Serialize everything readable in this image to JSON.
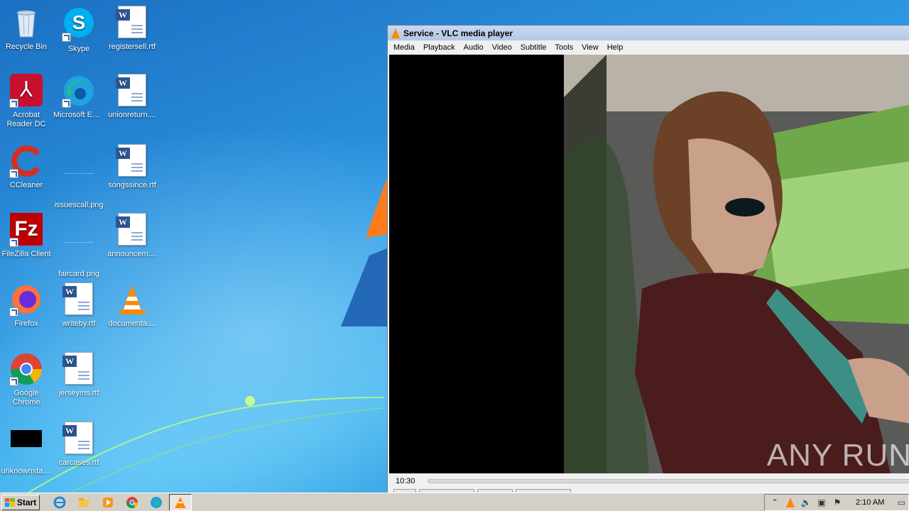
{
  "desktop": {
    "icons": [
      {
        "label": "Recycle Bin",
        "icon": "recycle-bin-icon"
      },
      {
        "label": "Skype",
        "icon": "skype-icon"
      },
      {
        "label": "registersell.rtf",
        "icon": "word-document-icon"
      },
      {
        "label": "Acrobat Reader DC",
        "icon": "acrobat-icon"
      },
      {
        "label": "Microsoft Edge",
        "icon": "edge-icon"
      },
      {
        "label": "unionreturn....",
        "icon": "word-document-icon"
      },
      {
        "label": "CCleaner",
        "icon": "ccleaner-icon"
      },
      {
        "label": "issuescall.png",
        "icon": "png-file-icon"
      },
      {
        "label": "songssince.rtf",
        "icon": "word-document-icon"
      },
      {
        "label": "FileZilla Client",
        "icon": "filezilla-icon"
      },
      {
        "label": "faircard.png",
        "icon": "png-file-icon"
      },
      {
        "label": "announcem....",
        "icon": "word-document-icon"
      },
      {
        "label": "Firefox",
        "icon": "firefox-icon"
      },
      {
        "label": "writeby.rtf",
        "icon": "word-document-icon"
      },
      {
        "label": "documenta....",
        "icon": "vlc-file-icon"
      },
      {
        "label": "Google Chrome",
        "icon": "chrome-icon"
      },
      {
        "label": "jerseyms.rtf",
        "icon": "word-document-icon"
      },
      {
        "label": "unknownsta....",
        "icon": "black-file-icon"
      },
      {
        "label": "carcases.rtf",
        "icon": "word-document-icon"
      }
    ]
  },
  "vlc": {
    "title": "Service - VLC media player",
    "menu": [
      "Media",
      "Playback",
      "Audio",
      "Video",
      "Subtitle",
      "Tools",
      "View",
      "Help"
    ],
    "time": "10:30",
    "watermark": "ANY RUN"
  },
  "taskbar": {
    "start_label": "Start",
    "apps": [
      "ie-icon",
      "explorer-icon",
      "media-player-icon",
      "chrome-icon",
      "edge-icon",
      "vlc-icon"
    ],
    "clock": "2:10 AM"
  }
}
